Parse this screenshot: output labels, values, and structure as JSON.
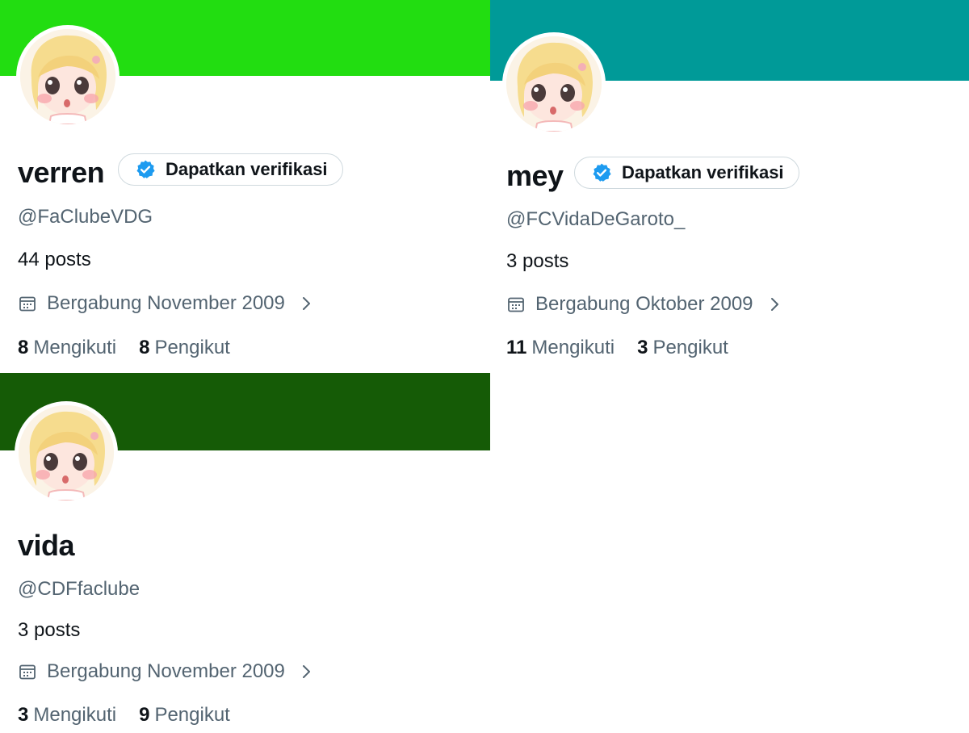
{
  "profiles": [
    {
      "banner_color": "#22dd11",
      "display_name": "verren",
      "verify_button_label": "Dapatkan verifikasi",
      "handle": "@FaClubeVDG",
      "posts": "44 posts",
      "joined": "Bergabung November 2009",
      "following_count": "8",
      "following_label": "Mengikuti",
      "followers_count": "8",
      "followers_label": "Pengikut"
    },
    {
      "banner_color": "#009a98",
      "display_name": "mey",
      "verify_button_label": "Dapatkan verifikasi",
      "handle": "@FCVidaDeGaroto_",
      "posts": "3 posts",
      "joined": "Bergabung Oktober 2009",
      "following_count": "11",
      "following_label": "Mengikuti",
      "followers_count": "3",
      "followers_label": "Pengikut"
    },
    {
      "banner_color": "#155b06",
      "display_name": "vida",
      "handle": "@CDFfaclube",
      "posts": "3 posts",
      "joined": "Bergabung November 2009",
      "following_count": "3",
      "following_label": "Mengikuti",
      "followers_count": "9",
      "followers_label": "Pengikut"
    }
  ],
  "icons": {
    "verified_badge": "verified-badge-icon",
    "calendar": "calendar-icon",
    "chevron": "chevron-right-icon"
  },
  "colors": {
    "verified_blue": "#1d9bf0",
    "secondary_text": "#536471",
    "primary_text": "#0f1419"
  }
}
